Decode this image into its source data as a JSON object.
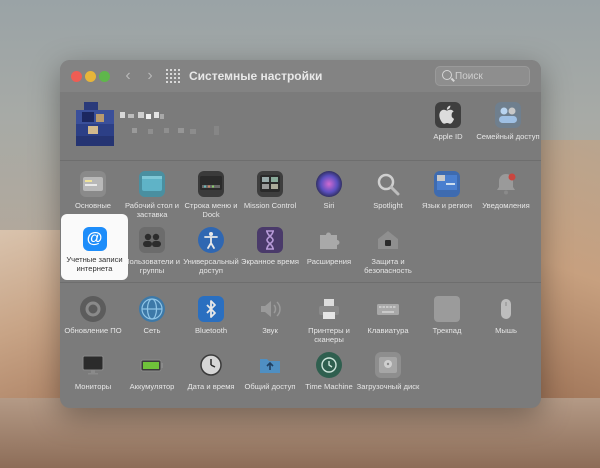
{
  "window": {
    "title": "Системные настройки"
  },
  "search": {
    "placeholder": "Поиск"
  },
  "account": {
    "apple_id_label": "Apple ID",
    "family_label": "Семейный доступ"
  },
  "row1": [
    {
      "label": "Основные",
      "icon": "general-icon"
    },
    {
      "label": "Рабочий стол и заставка",
      "icon": "desktop-icon"
    },
    {
      "label": "Строка меню и Dock",
      "icon": "dock-icon"
    },
    {
      "label": "Mission Control",
      "icon": "mission-control-icon"
    },
    {
      "label": "Siri",
      "icon": "siri-icon"
    },
    {
      "label": "Spotlight",
      "icon": "spotlight-icon"
    },
    {
      "label": "Язык и регион",
      "icon": "language-icon"
    },
    {
      "label": "Уведомления",
      "icon": "notifications-icon"
    }
  ],
  "row2": [
    {
      "label": "Учетные записи интернета",
      "icon": "internet-accounts-icon",
      "selected": true
    },
    {
      "label": "Пользователи и группы",
      "icon": "users-icon"
    },
    {
      "label": "Универсальный доступ",
      "icon": "accessibility-icon"
    },
    {
      "label": "Экранное время",
      "icon": "screen-time-icon"
    },
    {
      "label": "Расширения",
      "icon": "extensions-icon"
    },
    {
      "label": "Защита и безопасность",
      "icon": "security-icon"
    }
  ],
  "row3": [
    {
      "label": "Обновление ПО",
      "icon": "software-update-icon"
    },
    {
      "label": "Сеть",
      "icon": "network-icon"
    },
    {
      "label": "Bluetooth",
      "icon": "bluetooth-icon"
    },
    {
      "label": "Звук",
      "icon": "sound-icon"
    },
    {
      "label": "Принтеры и сканеры",
      "icon": "printer-icon"
    },
    {
      "label": "Клавиатура",
      "icon": "keyboard-icon"
    },
    {
      "label": "Трекпад",
      "icon": "trackpad-icon"
    },
    {
      "label": "Мышь",
      "icon": "mouse-icon"
    }
  ],
  "row4": [
    {
      "label": "Мониторы",
      "icon": "displays-icon"
    },
    {
      "label": "Аккумулятор",
      "icon": "battery-icon"
    },
    {
      "label": "Дата и время",
      "icon": "clock-icon"
    },
    {
      "label": "Общий доступ",
      "icon": "sharing-icon"
    },
    {
      "label": "Time Machine",
      "icon": "time-machine-icon"
    },
    {
      "label": "Загрузочный диск",
      "icon": "startup-disk-icon"
    }
  ],
  "colors": {
    "highlight": "#fafafa",
    "accent_blue": "#1d8dfa",
    "window_dim": "#7b7b7b"
  }
}
